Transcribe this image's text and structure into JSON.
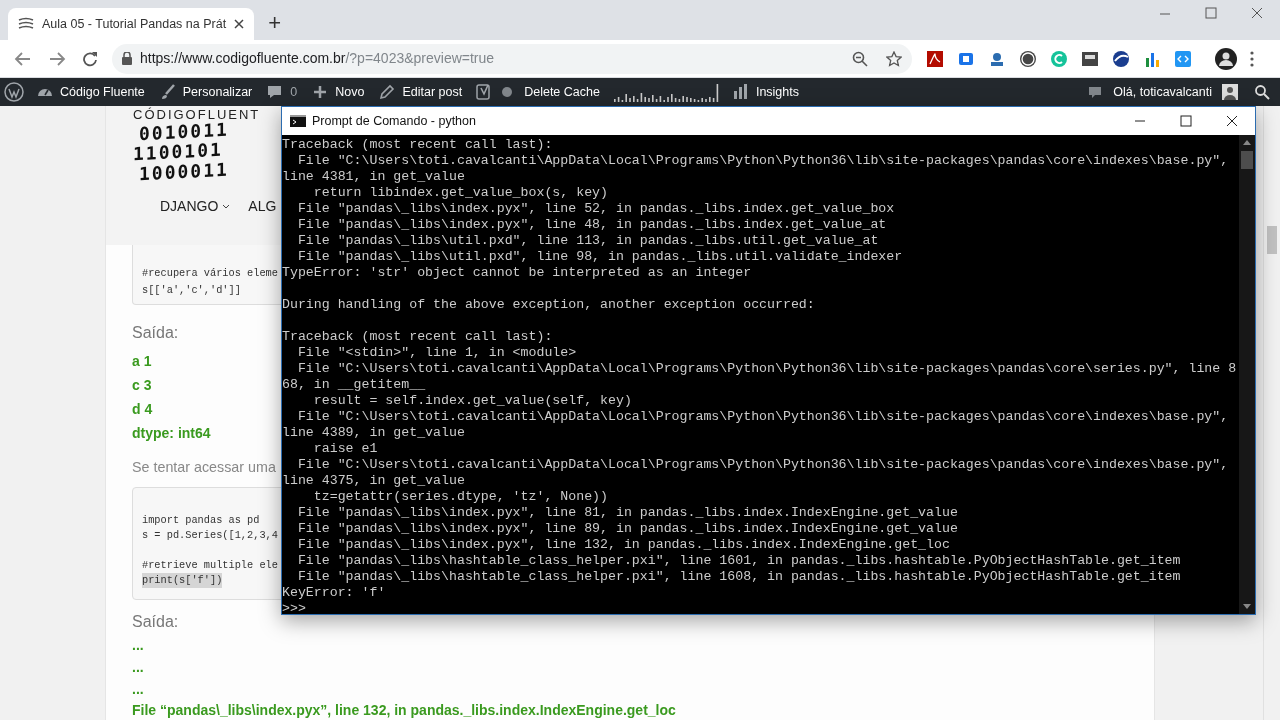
{
  "browser": {
    "tab": {
      "title": "Aula 05 - Tutorial Pandas na Prát",
      "selected": true
    },
    "new_tab": "+",
    "url_host": "https://www.codigofluente.com.br",
    "url_path": "/?p=4023&preview=true"
  },
  "admin_bar": {
    "items": [
      {
        "kind": "site",
        "label": "Código Fluente"
      },
      {
        "kind": "customize",
        "label": "Personalizar"
      },
      {
        "kind": "comments",
        "label": "0"
      },
      {
        "kind": "new",
        "label": "Novo"
      },
      {
        "kind": "edit",
        "label": "Editar post"
      },
      {
        "kind": "yoast"
      },
      {
        "kind": "dot"
      },
      {
        "kind": "cache",
        "label": "Delete Cache"
      },
      {
        "kind": "sparkline"
      },
      {
        "kind": "insights",
        "label": "Insights"
      }
    ],
    "greeting": "Olá, toticavalcanti"
  },
  "site": {
    "logo_title": "CÓDIGOFLUENT",
    "logo_rows": [
      "0010011",
      "1100101",
      "1000011"
    ],
    "nav": [
      {
        "label": "DJANGO",
        "dropdown": true
      },
      {
        "label": "ALG",
        "dropdown": false
      }
    ]
  },
  "article": {
    "code_block_1": [
      "#recupera vários eleme",
      "s[['a','c','d']]"
    ],
    "output_label_1": "Saída:",
    "output_1": [
      "a 1",
      "c 3",
      "d 4",
      "dtype: int64"
    ],
    "paragraph": "Se tentar acessar uma",
    "code_block_2": [
      [
        {
          "text": "import pandas as pd",
          "highlighted": false
        },
        {
          "text": "s = pd.Series([1,2,3,4",
          "highlighted": false
        }
      ],
      [
        {
          "text": "#retrieve multiple ele",
          "highlighted": false
        },
        {
          "text": "print(s['f'])",
          "highlighted": true
        }
      ]
    ],
    "output_label_2": "Saída:",
    "output_2": [
      "...",
      "...",
      "...",
      "File “pandas\\_libs\\index.pyx”, line 132, in pandas._libs.index.IndexEngine.get_loc"
    ]
  },
  "console": {
    "title": "Prompt de Comando - python",
    "blocks": [
      [
        "Traceback (most recent call last):",
        "  File \"C:\\Users\\toti.cavalcanti\\AppData\\Local\\Programs\\Python\\Python36\\lib\\site-packages\\pandas\\core\\indexes\\base.py\",",
        "line 4381, in get_value",
        "    return libindex.get_value_box(s, key)",
        "  File \"pandas\\_libs\\index.pyx\", line 52, in pandas._libs.index.get_value_box",
        "  File \"pandas\\_libs\\index.pyx\", line 48, in pandas._libs.index.get_value_at",
        "  File \"pandas\\_libs\\util.pxd\", line 113, in pandas._libs.util.get_value_at",
        "  File \"pandas\\_libs\\util.pxd\", line 98, in pandas._libs.util.validate_indexer",
        "TypeError: 'str' object cannot be interpreted as an integer"
      ],
      [
        "During handling of the above exception, another exception occurred:"
      ],
      [
        "Traceback (most recent call last):",
        "  File \"<stdin>\", line 1, in <module>",
        "  File \"C:\\Users\\toti.cavalcanti\\AppData\\Local\\Programs\\Python\\Python36\\lib\\site-packages\\pandas\\core\\series.py\", line 8",
        "68, in __getitem__",
        "    result = self.index.get_value(self, key)",
        "  File \"C:\\Users\\toti.cavalcanti\\AppData\\Local\\Programs\\Python\\Python36\\lib\\site-packages\\pandas\\core\\indexes\\base.py\",",
        "line 4389, in get_value",
        "    raise e1",
        "  File \"C:\\Users\\toti.cavalcanti\\AppData\\Local\\Programs\\Python\\Python36\\lib\\site-packages\\pandas\\core\\indexes\\base.py\",",
        "line 4375, in get_value",
        "    tz=getattr(series.dtype, 'tz', None))",
        "  File \"pandas\\_libs\\index.pyx\", line 81, in pandas._libs.index.IndexEngine.get_value",
        "  File \"pandas\\_libs\\index.pyx\", line 89, in pandas._libs.index.IndexEngine.get_value",
        "  File \"pandas\\_libs\\index.pyx\", line 132, in pandas._libs.index.IndexEngine.get_loc",
        "  File \"pandas\\_libs\\hashtable_class_helper.pxi\", line 1601, in pandas._libs.hashtable.PyObjectHashTable.get_item",
        "  File \"pandas\\_libs\\hashtable_class_helper.pxi\", line 1608, in pandas._libs.hashtable.PyObjectHashTable.get_item",
        "KeyError: 'f'",
        ">>>"
      ]
    ]
  }
}
